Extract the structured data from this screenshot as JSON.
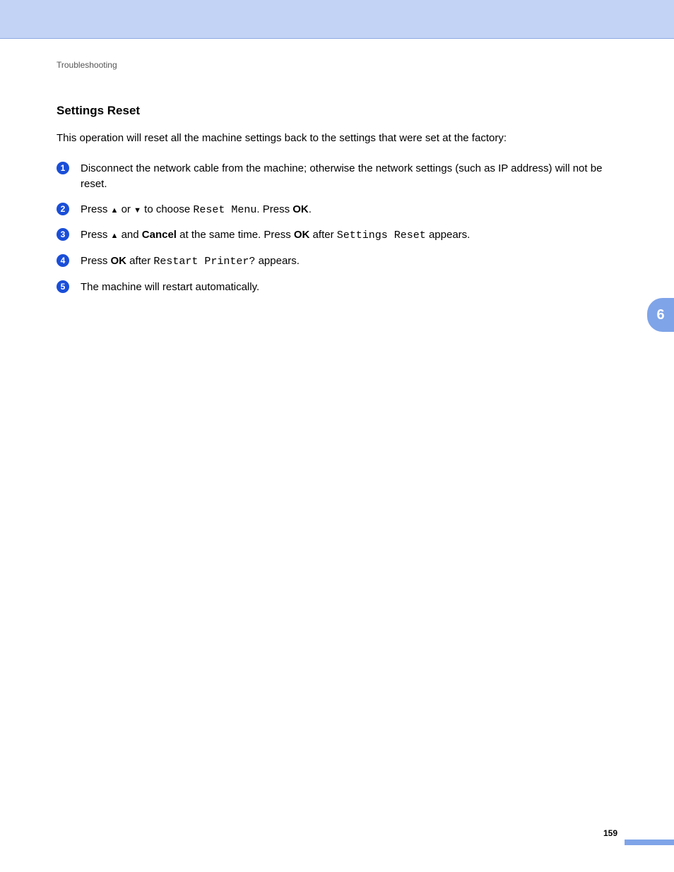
{
  "breadcrumb": "Troubleshooting",
  "section_title": "Settings Reset",
  "intro": "This operation will reset all the machine settings back to the settings that were set at the factory:",
  "steps": [
    {
      "num": "1",
      "text": "Disconnect the network cable from the machine; otherwise the network settings (such as IP address) will not be reset."
    },
    {
      "num": "2",
      "t1": "Press ",
      "arrow_up": "▲",
      "t2": " or ",
      "arrow_down": "▼",
      "t3": " to choose ",
      "mono1": "Reset Menu",
      "t4": ". Press ",
      "bold1": "OK",
      "t5": "."
    },
    {
      "num": "3",
      "t1": "Press ",
      "arrow_up": "▲",
      "t2": " and ",
      "bold1": "Cancel",
      "t3": " at the same time. Press ",
      "bold2": "OK",
      "t4": " after ",
      "mono1": "Settings Reset",
      "t5": " appears."
    },
    {
      "num": "4",
      "t1": "Press ",
      "bold1": "OK",
      "t2": " after ",
      "mono1": "Restart Printer?",
      "t3": " appears."
    },
    {
      "num": "5",
      "text": "The machine will restart automatically."
    }
  ],
  "side_tab": "6",
  "page_number": "159"
}
